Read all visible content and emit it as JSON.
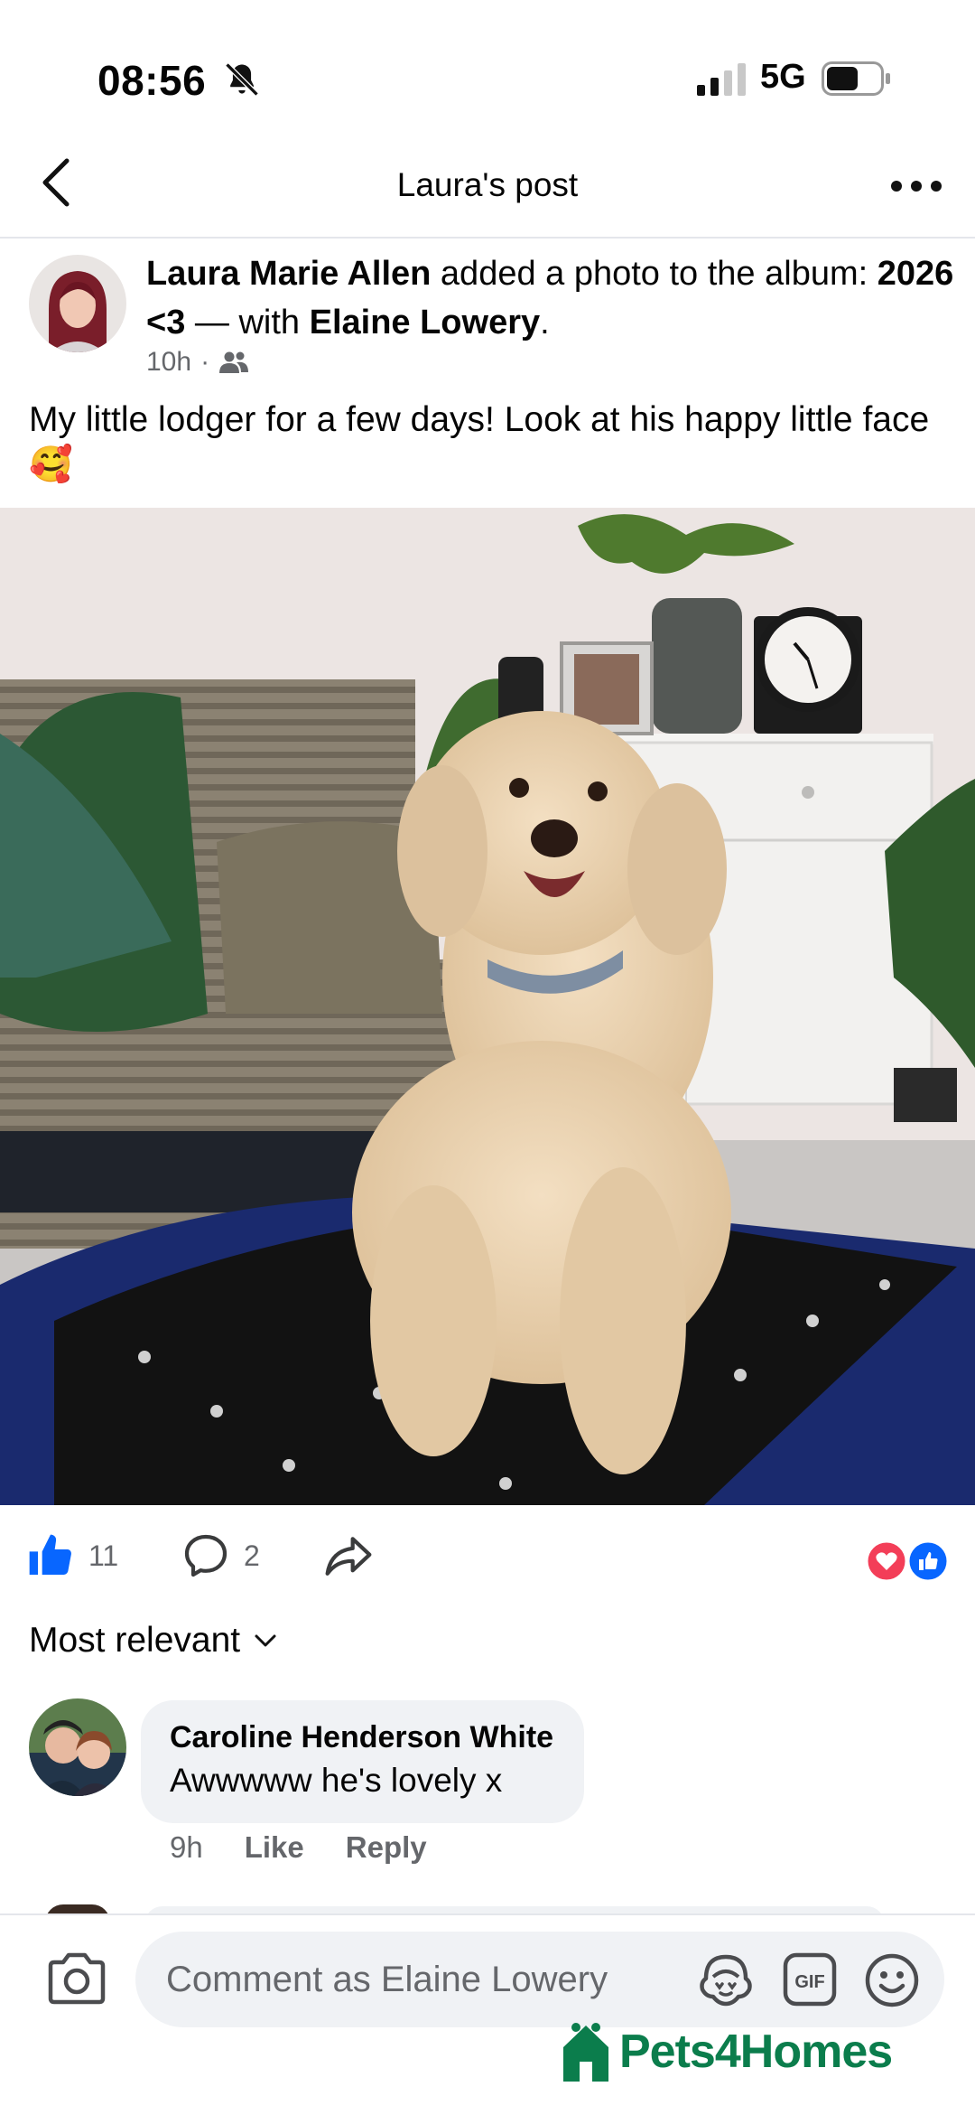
{
  "status_bar": {
    "time": "08:56",
    "network": "5G"
  },
  "nav": {
    "title": "Laura's post"
  },
  "post": {
    "author": "Laura Marie Allen",
    "action": "added a photo to the album:",
    "album": "2026 <3",
    "with_prefix": "— with",
    "tagged": "Elaine Lowery",
    "period": ".",
    "time": "10h",
    "separator": "·",
    "text": "My little lodger for a few days! Look at his happy little face",
    "emoji": "🥰"
  },
  "reactions": {
    "likes": "11",
    "comments": "2"
  },
  "sort": {
    "label": "Most relevant"
  },
  "comment": {
    "author": "Caroline Henderson White",
    "text": "Awwwww he's lovely x",
    "time": "9h",
    "like_label": "Like",
    "reply_label": "Reply"
  },
  "composer": {
    "placeholder": "Comment as Elaine Lowery",
    "gif_label": "GIF"
  },
  "watermark": {
    "text": "Pets4Homes"
  },
  "colors": {
    "accent": "#0866ff",
    "love": "#f33e58",
    "muted": "#65676b",
    "bubble": "#f0f2f5",
    "brand": "#0b7d4c"
  }
}
